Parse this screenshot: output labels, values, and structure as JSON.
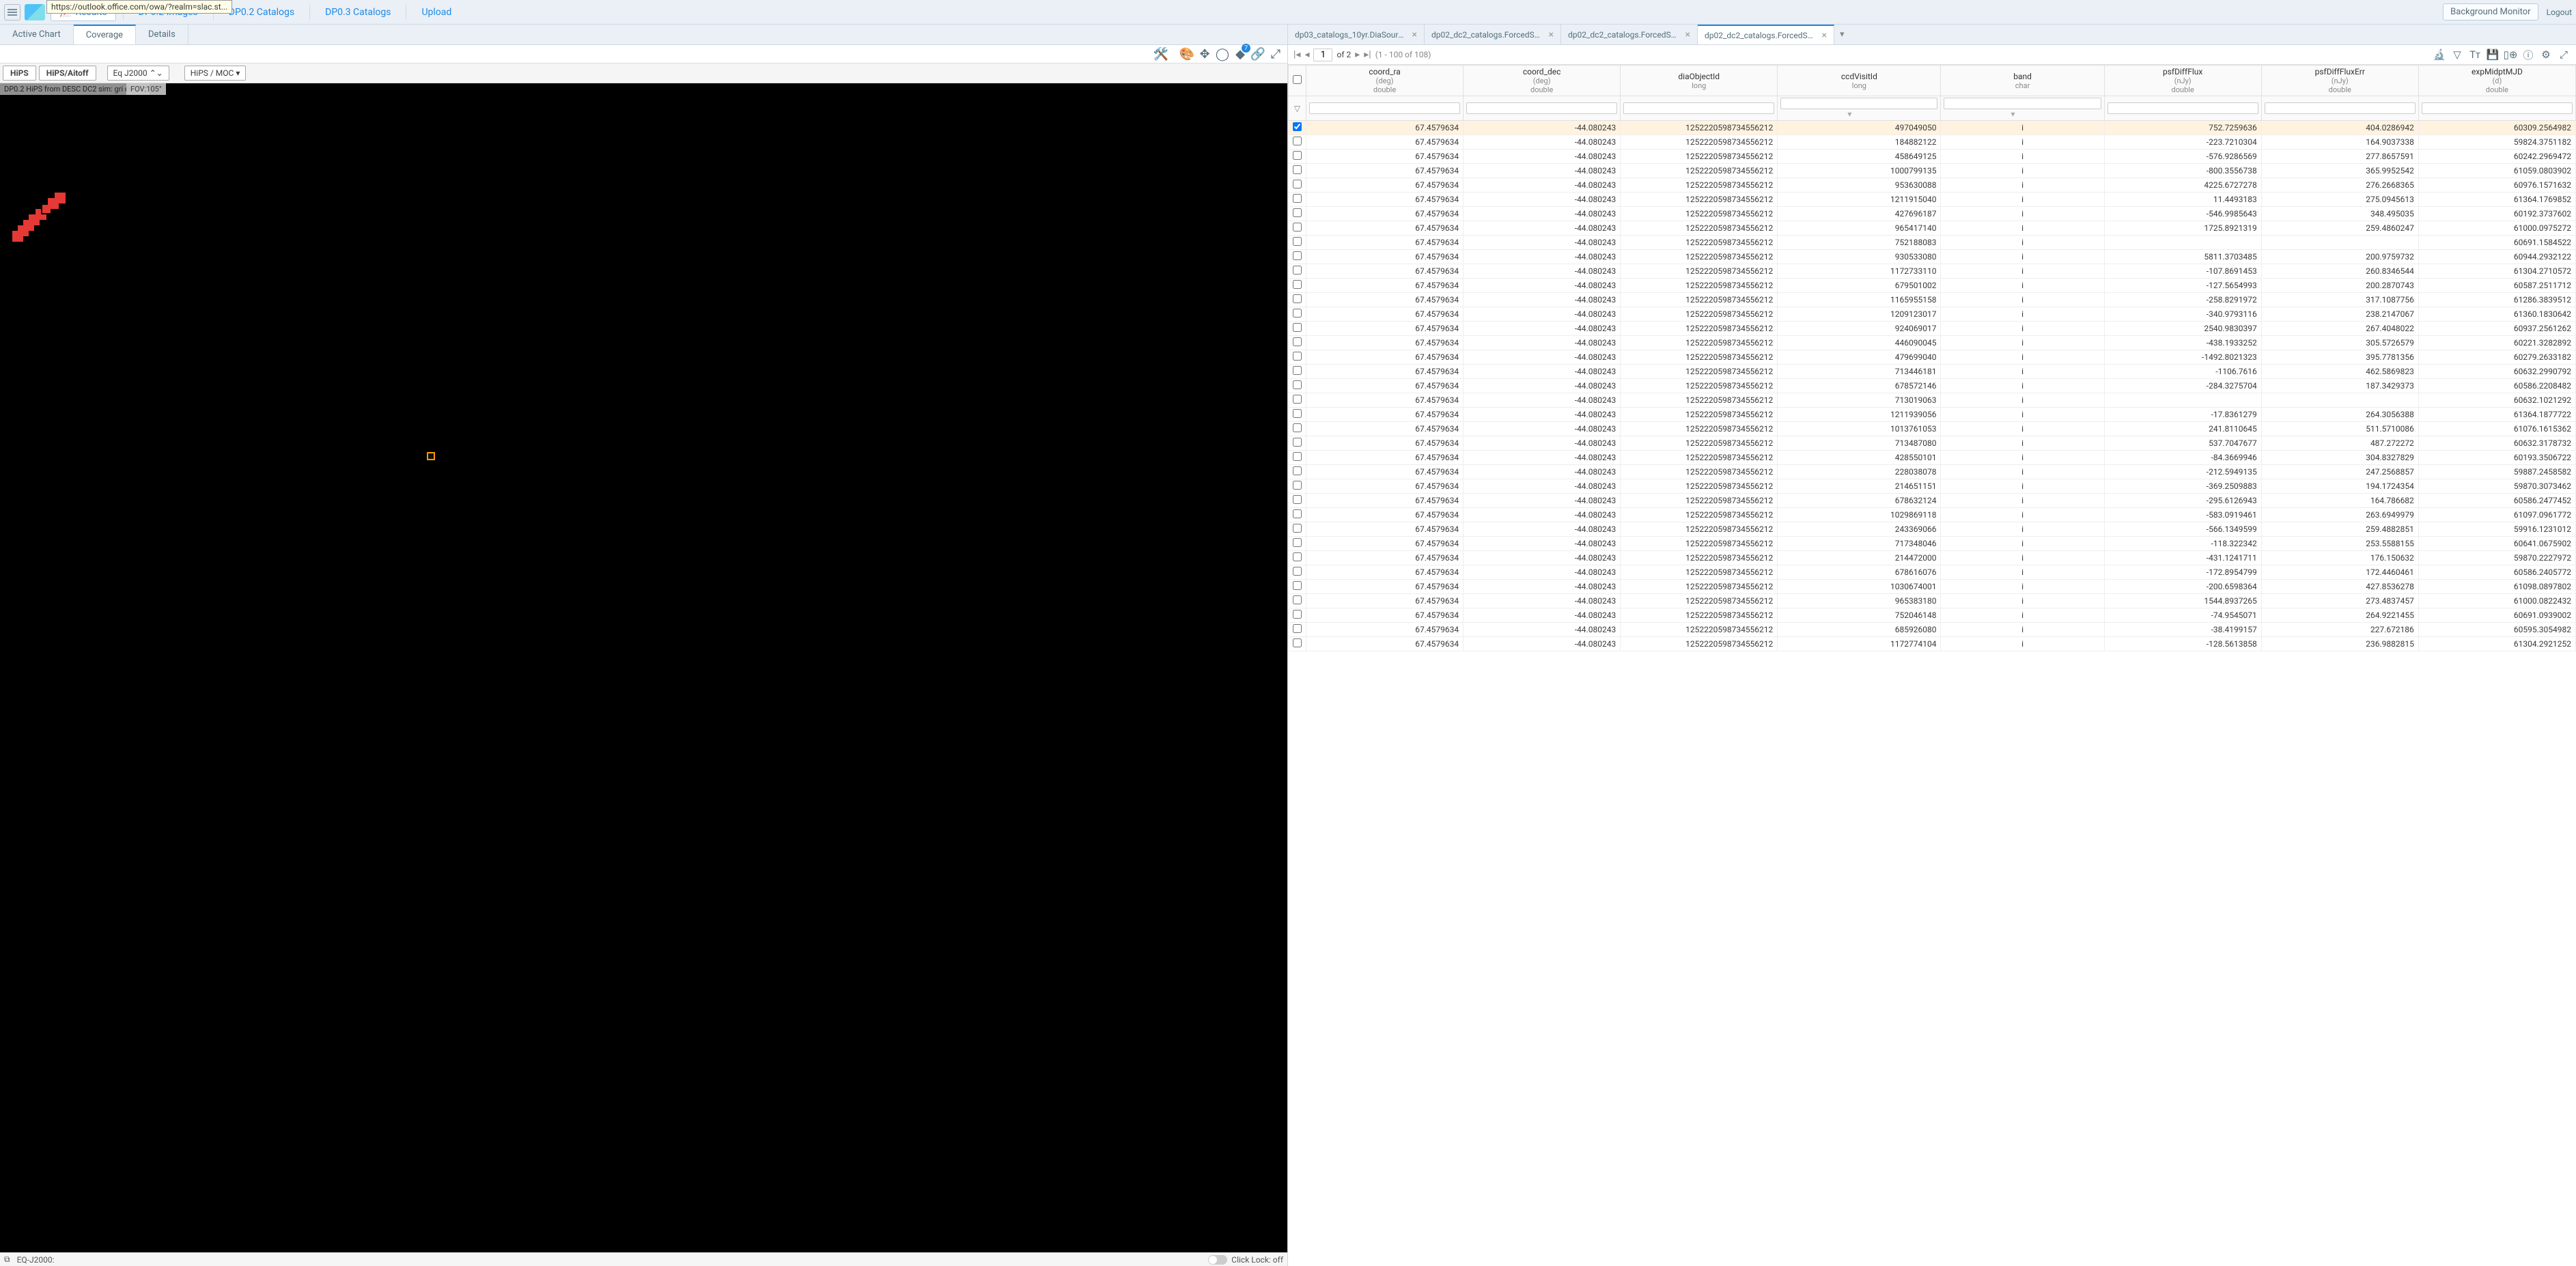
{
  "tooltip_url": "https://outlook.office.com/owa/?realm=slac.st...",
  "nav": {
    "results": "Results",
    "images": "DP0.2 Images",
    "catalogs02": "DP0.2 Catalogs",
    "catalogs03": "DP0.3 Catalogs",
    "upload": "Upload"
  },
  "top_right": {
    "bg_monitor": "Background Monitor",
    "logout": "Logout"
  },
  "view_tabs": {
    "active_chart": "Active Chart",
    "coverage": "Coverage",
    "details": "Details"
  },
  "layers_badge": "7",
  "hips_bar": {
    "hips": "HiPS",
    "aitoff": "HiPS/Aitoff",
    "frame": "Eq J2000",
    "moc": "HiPS / MOC"
  },
  "image_caption": "DP0.2 HiPS from DESC DC2 sim: gri colo...",
  "fov_label": "FOV:105°",
  "status": {
    "readout_label": "EQ-J2000:",
    "click_lock": "Click Lock: off"
  },
  "table_tabs": [
    {
      "label": "dp03_catalogs_10yr.DiaSource - ...",
      "active": false
    },
    {
      "label": "dp02_dc2_catalogs.ForcedSour...",
      "active": false
    },
    {
      "label": "dp02_dc2_catalogs.ForcedSour...",
      "active": false
    },
    {
      "label": "dp02_dc2_catalogs.ForcedSour...",
      "active": true
    }
  ],
  "pager": {
    "page": "1",
    "total": "of 2",
    "range": "(1 - 100 of 108)"
  },
  "columns": [
    {
      "name": "coord_ra",
      "unit": "(deg)",
      "dtype": "double"
    },
    {
      "name": "coord_dec",
      "unit": "(deg)",
      "dtype": "double"
    },
    {
      "name": "diaObjectId",
      "unit": "",
      "dtype": "long"
    },
    {
      "name": "ccdVisitId",
      "unit": "",
      "dtype": "long"
    },
    {
      "name": "band",
      "unit": "",
      "dtype": "char"
    },
    {
      "name": "psfDiffFlux",
      "unit": "(nJy)",
      "dtype": "double"
    },
    {
      "name": "psfDiffFluxErr",
      "unit": "(nJy)",
      "dtype": "double"
    },
    {
      "name": "expMidptMJD",
      "unit": "(d)",
      "dtype": "double"
    }
  ],
  "rows": [
    {
      "sel": true,
      "ra": "67.4579634",
      "dec": "-44.080243",
      "dia": "1252220598734556212",
      "ccd": "497049050",
      "band": "i",
      "flux": "752.7259636",
      "fluxerr": "404.0286942",
      "mjd": "60309.2564982"
    },
    {
      "sel": false,
      "ra": "67.4579634",
      "dec": "-44.080243",
      "dia": "1252220598734556212",
      "ccd": "184882122",
      "band": "i",
      "flux": "-223.7210304",
      "fluxerr": "164.9037338",
      "mjd": "59824.3751182"
    },
    {
      "sel": false,
      "ra": "67.4579634",
      "dec": "-44.080243",
      "dia": "1252220598734556212",
      "ccd": "458649125",
      "band": "i",
      "flux": "-576.9286569",
      "fluxerr": "277.8657591",
      "mjd": "60242.2969472"
    },
    {
      "sel": false,
      "ra": "67.4579634",
      "dec": "-44.080243",
      "dia": "1252220598734556212",
      "ccd": "1000799135",
      "band": "i",
      "flux": "-800.3556738",
      "fluxerr": "365.9952542",
      "mjd": "61059.0803902"
    },
    {
      "sel": false,
      "ra": "67.4579634",
      "dec": "-44.080243",
      "dia": "1252220598734556212",
      "ccd": "953630088",
      "band": "i",
      "flux": "4225.6727278",
      "fluxerr": "276.2668365",
      "mjd": "60976.1571632"
    },
    {
      "sel": false,
      "ra": "67.4579634",
      "dec": "-44.080243",
      "dia": "1252220598734556212",
      "ccd": "1211915040",
      "band": "i",
      "flux": "11.4493183",
      "fluxerr": "275.0945613",
      "mjd": "61364.1769852"
    },
    {
      "sel": false,
      "ra": "67.4579634",
      "dec": "-44.080243",
      "dia": "1252220598734556212",
      "ccd": "427696187",
      "band": "i",
      "flux": "-546.9985643",
      "fluxerr": "348.495035",
      "mjd": "60192.3737602"
    },
    {
      "sel": false,
      "ra": "67.4579634",
      "dec": "-44.080243",
      "dia": "1252220598734556212",
      "ccd": "965417140",
      "band": "i",
      "flux": "1725.8921319",
      "fluxerr": "259.4860247",
      "mjd": "61000.0975272"
    },
    {
      "sel": false,
      "ra": "67.4579634",
      "dec": "-44.080243",
      "dia": "1252220598734556212",
      "ccd": "752188083",
      "band": "i",
      "flux": "",
      "fluxerr": "",
      "mjd": "60691.1584522"
    },
    {
      "sel": false,
      "ra": "67.4579634",
      "dec": "-44.080243",
      "dia": "1252220598734556212",
      "ccd": "930533080",
      "band": "i",
      "flux": "5811.3703485",
      "fluxerr": "200.9759732",
      "mjd": "60944.2932122"
    },
    {
      "sel": false,
      "ra": "67.4579634",
      "dec": "-44.080243",
      "dia": "1252220598734556212",
      "ccd": "1172733110",
      "band": "i",
      "flux": "-107.8691453",
      "fluxerr": "260.8346544",
      "mjd": "61304.2710572"
    },
    {
      "sel": false,
      "ra": "67.4579634",
      "dec": "-44.080243",
      "dia": "1252220598734556212",
      "ccd": "679501002",
      "band": "i",
      "flux": "-127.5654993",
      "fluxerr": "200.2870743",
      "mjd": "60587.2511712"
    },
    {
      "sel": false,
      "ra": "67.4579634",
      "dec": "-44.080243",
      "dia": "1252220598734556212",
      "ccd": "1165955158",
      "band": "i",
      "flux": "-258.8291972",
      "fluxerr": "317.1087756",
      "mjd": "61286.3839512"
    },
    {
      "sel": false,
      "ra": "67.4579634",
      "dec": "-44.080243",
      "dia": "1252220598734556212",
      "ccd": "1209123017",
      "band": "i",
      "flux": "-340.9793116",
      "fluxerr": "238.2147067",
      "mjd": "61360.1830642"
    },
    {
      "sel": false,
      "ra": "67.4579634",
      "dec": "-44.080243",
      "dia": "1252220598734556212",
      "ccd": "924069017",
      "band": "i",
      "flux": "2540.9830397",
      "fluxerr": "267.4048022",
      "mjd": "60937.2561262"
    },
    {
      "sel": false,
      "ra": "67.4579634",
      "dec": "-44.080243",
      "dia": "1252220598734556212",
      "ccd": "446090045",
      "band": "i",
      "flux": "-438.1933252",
      "fluxerr": "305.5726579",
      "mjd": "60221.3282892"
    },
    {
      "sel": false,
      "ra": "67.4579634",
      "dec": "-44.080243",
      "dia": "1252220598734556212",
      "ccd": "479699040",
      "band": "i",
      "flux": "-1492.8021323",
      "fluxerr": "395.7781356",
      "mjd": "60279.2633182"
    },
    {
      "sel": false,
      "ra": "67.4579634",
      "dec": "-44.080243",
      "dia": "1252220598734556212",
      "ccd": "713446181",
      "band": "i",
      "flux": "-1106.7616",
      "fluxerr": "462.5869823",
      "mjd": "60632.2990792"
    },
    {
      "sel": false,
      "ra": "67.4579634",
      "dec": "-44.080243",
      "dia": "1252220598734556212",
      "ccd": "678572146",
      "band": "i",
      "flux": "-284.3275704",
      "fluxerr": "187.3429373",
      "mjd": "60586.2208482"
    },
    {
      "sel": false,
      "ra": "67.4579634",
      "dec": "-44.080243",
      "dia": "1252220598734556212",
      "ccd": "713019063",
      "band": "i",
      "flux": "",
      "fluxerr": "",
      "mjd": "60632.1021292"
    },
    {
      "sel": false,
      "ra": "67.4579634",
      "dec": "-44.080243",
      "dia": "1252220598734556212",
      "ccd": "1211939056",
      "band": "i",
      "flux": "-17.8361279",
      "fluxerr": "264.3056388",
      "mjd": "61364.1877722"
    },
    {
      "sel": false,
      "ra": "67.4579634",
      "dec": "-44.080243",
      "dia": "1252220598734556212",
      "ccd": "1013761053",
      "band": "i",
      "flux": "241.8110645",
      "fluxerr": "511.5710086",
      "mjd": "61076.1615362"
    },
    {
      "sel": false,
      "ra": "67.4579634",
      "dec": "-44.080243",
      "dia": "1252220598734556212",
      "ccd": "713487080",
      "band": "i",
      "flux": "537.7047677",
      "fluxerr": "487.272272",
      "mjd": "60632.3178732"
    },
    {
      "sel": false,
      "ra": "67.4579634",
      "dec": "-44.080243",
      "dia": "1252220598734556212",
      "ccd": "428550101",
      "band": "i",
      "flux": "-84.3669946",
      "fluxerr": "304.8327829",
      "mjd": "60193.3506722"
    },
    {
      "sel": false,
      "ra": "67.4579634",
      "dec": "-44.080243",
      "dia": "1252220598734556212",
      "ccd": "228038078",
      "band": "i",
      "flux": "-212.5949135",
      "fluxerr": "247.2568857",
      "mjd": "59887.2458582"
    },
    {
      "sel": false,
      "ra": "67.4579634",
      "dec": "-44.080243",
      "dia": "1252220598734556212",
      "ccd": "214651151",
      "band": "i",
      "flux": "-369.2509883",
      "fluxerr": "194.1724354",
      "mjd": "59870.3073462"
    },
    {
      "sel": false,
      "ra": "67.4579634",
      "dec": "-44.080243",
      "dia": "1252220598734556212",
      "ccd": "678632124",
      "band": "i",
      "flux": "-295.6126943",
      "fluxerr": "164.786682",
      "mjd": "60586.2477452"
    },
    {
      "sel": false,
      "ra": "67.4579634",
      "dec": "-44.080243",
      "dia": "1252220598734556212",
      "ccd": "1029869118",
      "band": "i",
      "flux": "-583.0919461",
      "fluxerr": "263.6949979",
      "mjd": "61097.0961772"
    },
    {
      "sel": false,
      "ra": "67.4579634",
      "dec": "-44.080243",
      "dia": "1252220598734556212",
      "ccd": "243369066",
      "band": "i",
      "flux": "-566.1349599",
      "fluxerr": "259.4882851",
      "mjd": "59916.1231012"
    },
    {
      "sel": false,
      "ra": "67.4579634",
      "dec": "-44.080243",
      "dia": "1252220598734556212",
      "ccd": "717348046",
      "band": "i",
      "flux": "-118.322342",
      "fluxerr": "253.5588155",
      "mjd": "60641.0675902"
    },
    {
      "sel": false,
      "ra": "67.4579634",
      "dec": "-44.080243",
      "dia": "1252220598734556212",
      "ccd": "214472000",
      "band": "i",
      "flux": "-431.1241711",
      "fluxerr": "176.150632",
      "mjd": "59870.2227972"
    },
    {
      "sel": false,
      "ra": "67.4579634",
      "dec": "-44.080243",
      "dia": "1252220598734556212",
      "ccd": "678616076",
      "band": "i",
      "flux": "-172.8954799",
      "fluxerr": "172.4460461",
      "mjd": "60586.2405772"
    },
    {
      "sel": false,
      "ra": "67.4579634",
      "dec": "-44.080243",
      "dia": "1252220598734556212",
      "ccd": "1030674001",
      "band": "i",
      "flux": "-200.6598364",
      "fluxerr": "427.8536278",
      "mjd": "61098.0897802"
    },
    {
      "sel": false,
      "ra": "67.4579634",
      "dec": "-44.080243",
      "dia": "1252220598734556212",
      "ccd": "965383180",
      "band": "i",
      "flux": "1544.8937265",
      "fluxerr": "273.4837457",
      "mjd": "61000.0822432"
    },
    {
      "sel": false,
      "ra": "67.4579634",
      "dec": "-44.080243",
      "dia": "1252220598734556212",
      "ccd": "752046148",
      "band": "i",
      "flux": "-74.9545071",
      "fluxerr": "264.9221455",
      "mjd": "60691.0939002"
    },
    {
      "sel": false,
      "ra": "67.4579634",
      "dec": "-44.080243",
      "dia": "1252220598734556212",
      "ccd": "685926080",
      "band": "i",
      "flux": "-38.4199157",
      "fluxerr": "227.672186",
      "mjd": "60595.3054982"
    },
    {
      "sel": false,
      "ra": "67.4579634",
      "dec": "-44.080243",
      "dia": "1252220598734556212",
      "ccd": "1172774104",
      "band": "i",
      "flux": "-128.5613858",
      "fluxerr": "236.9882815",
      "mjd": "61304.2921252"
    }
  ]
}
